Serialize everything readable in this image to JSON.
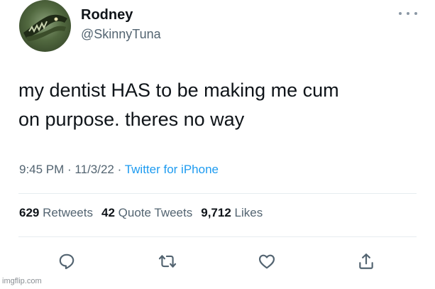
{
  "user": {
    "display_name": "Rodney",
    "handle": "@SkinnyTuna"
  },
  "tweet": {
    "text_line1": "my dentist HAS to be making me cum",
    "text_line2": "on purpose. theres no way",
    "time": "9:45 PM",
    "date": "11/3/22",
    "source": "Twitter for iPhone",
    "separator": " · "
  },
  "stats": {
    "retweets_count": "629",
    "retweets_label": "Retweets",
    "quotes_count": "42",
    "quotes_label": "Quote Tweets",
    "likes_count": "9,712",
    "likes_label": "Likes"
  },
  "icons": {
    "more": "more-icon",
    "reply": "reply-icon",
    "retweet": "retweet-icon",
    "like": "heart-icon",
    "share": "share-icon"
  },
  "colors": {
    "text": "#0f1419",
    "secondary": "#536471",
    "link": "#1d9bf0",
    "divider": "#e6ecf0"
  },
  "watermark": "imgflip.com"
}
